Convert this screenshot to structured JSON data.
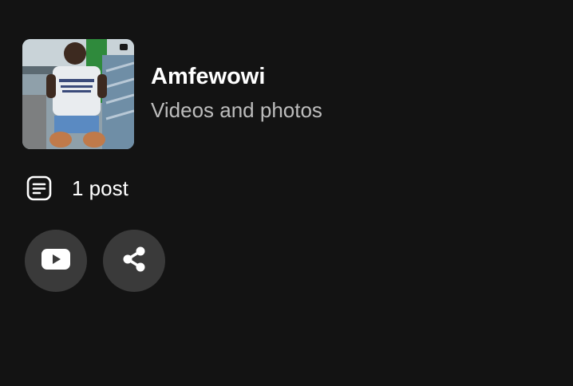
{
  "channel": {
    "name": "Amfewowi",
    "subtitle": "Videos and photos",
    "thumbnail_icon": "channel-thumbnail"
  },
  "stats": {
    "posts_label": "1 post",
    "posts_icon": "document-lines-icon"
  },
  "actions": {
    "youtube_icon": "youtube-icon",
    "share_icon": "share-icon"
  },
  "colors": {
    "background": "#131313",
    "button_bg": "#3a3a3a",
    "title": "#ffffff",
    "subtitle": "#bdbdbd"
  }
}
